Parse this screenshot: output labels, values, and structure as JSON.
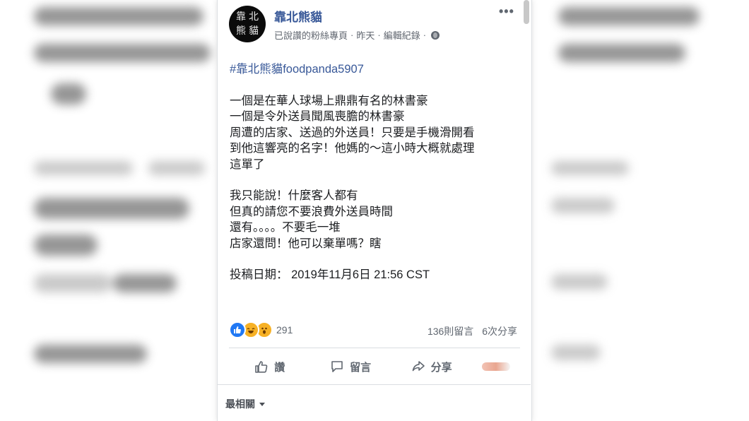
{
  "post": {
    "page_name": "靠北熊貓",
    "avatar_text": [
      "靠",
      "北",
      "熊",
      "貓"
    ],
    "meta": {
      "follow_status": "已說讚的粉絲專頁",
      "time": "昨天",
      "edit_history": "編輯紀錄",
      "separator": "·"
    },
    "more_label": "•••",
    "hashtag": "#靠北熊貓",
    "tag_suffix": "foodpanda5907",
    "paragraph1": [
      "一個是在華人球場上鼎鼎有名的林書豪",
      "一個是令外送員聞風喪膽的林書豪",
      "周遭的店家、送過的外送員！只要是手機滑開看",
      "到他這響亮的名字！他媽的～這小時大概就處理",
      "這單了"
    ],
    "paragraph2": [
      "我只能說！什麼客人都有",
      "但真的請您不要浪費外送員時間",
      "還有。。。。不要毛一堆",
      "店家還問！他可以棄單嗎？瞎"
    ],
    "date_line": "投稿日期： 2019年11月6日 21:56 CST"
  },
  "engagement": {
    "reaction_count": "291",
    "comments": "136則留言",
    "shares": "6次分享"
  },
  "actions": {
    "like": "讚",
    "comment": "留言",
    "share": "分享"
  },
  "comment_sort": "最相關",
  "colors": {
    "link": "#385898",
    "text": "#1c1e21",
    "muted": "#606770",
    "like_blue": "#2078f4"
  }
}
